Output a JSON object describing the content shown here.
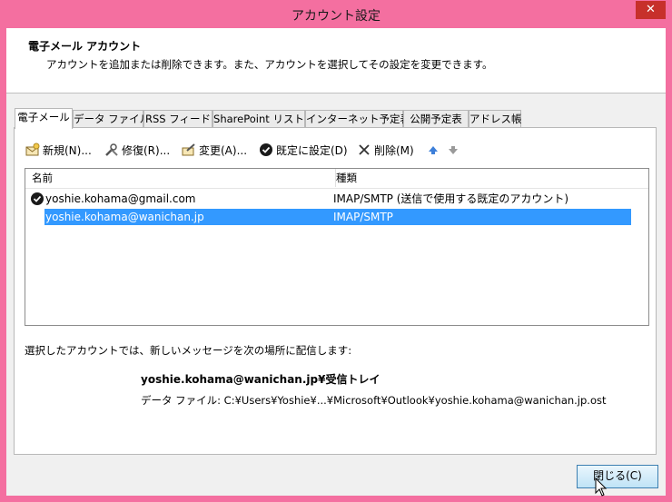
{
  "window": {
    "title": "アカウント設定",
    "close_glyph": "✕"
  },
  "header": {
    "title": "電子メール アカウント",
    "description": "アカウントを追加または削除できます。また、アカウントを選択してその設定を変更できます。"
  },
  "tabs": [
    {
      "label": "電子メール",
      "active": true
    },
    {
      "label": "データ ファイル",
      "active": false
    },
    {
      "label": "RSS フィード",
      "active": false
    },
    {
      "label": "SharePoint リスト",
      "active": false
    },
    {
      "label": "インターネット予定表",
      "active": false
    },
    {
      "label": "公開予定表",
      "active": false
    },
    {
      "label": "アドレス帳",
      "active": false
    }
  ],
  "toolbar": {
    "new": "新規(N)...",
    "repair": "修復(R)...",
    "change": "変更(A)...",
    "set_default": "既定に設定(D)",
    "delete": "削除(M)"
  },
  "list": {
    "col_name": "名前",
    "col_type": "種類",
    "rows": [
      {
        "name": "yoshie.kohama@gmail.com",
        "type": "IMAP/SMTP (送信で使用する既定のアカウント)",
        "default": true,
        "selected": false
      },
      {
        "name": "yoshie.kohama@wanichan.jp",
        "type": "IMAP/SMTP",
        "default": false,
        "selected": true
      }
    ]
  },
  "delivery": {
    "label": "選択したアカウントでは、新しいメッセージを次の場所に配信します:",
    "location": "yoshie.kohama@wanichan.jp¥受信トレイ",
    "data_file": "データ ファイル: C:¥Users¥Yoshie¥...¥Microsoft¥Outlook¥yoshie.kohama@wanichan.jp.ost"
  },
  "footer": {
    "close_label": "閉じる(C)"
  },
  "colors": {
    "accent": "#f46fa0",
    "selection": "#3399ff",
    "close": "#c7302b"
  }
}
